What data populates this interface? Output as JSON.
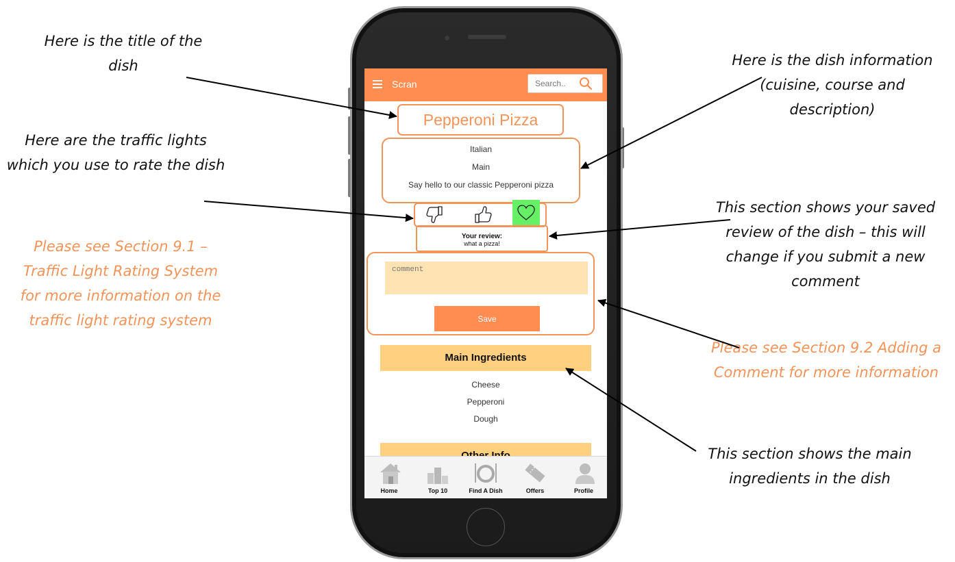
{
  "annotations": {
    "title_note": "Here is the title of the dish",
    "traffic_note": "Here are the traffic lights which you use to rate the dish",
    "section91_note": "Please see Section 9.1 – Traffic Light Rating System for more information on the traffic light rating system",
    "info_note": "Here is the dish information (cuisine, course and description)",
    "review_note": "This section shows your saved review of the dish – this will change if you submit a new comment",
    "section92_note": "Please see Section 9.2 Adding a Comment for more information",
    "ingredients_note": "This section shows the main ingredients in the dish"
  },
  "colors": {
    "accent": "#ff8c50",
    "annotation_orange": "#f2945a",
    "header_yellow": "#ffd080",
    "input_bg": "#ffe3b3",
    "favorite_green": "#66f066"
  },
  "app": {
    "title": "Scran",
    "search_placeholder": "Search..",
    "menu_icon": "hamburger-menu-icon",
    "search_icon": "magnifier-icon"
  },
  "dish": {
    "title": "Pepperoni Pizza",
    "cuisine": "Italian",
    "course": "Main",
    "description": "Say hello to our classic Pepperoni pizza"
  },
  "rating": {
    "icons": [
      "thumbs-down-icon",
      "thumbs-up-icon",
      "heart-icon"
    ],
    "selected": "heart"
  },
  "review": {
    "label": "Your review:",
    "text": "what a pizza!"
  },
  "comment": {
    "placeholder": "comment",
    "save_label": "Save"
  },
  "ingredients": {
    "header": "Main Ingredients",
    "items": [
      "Cheese",
      "Pepperoni",
      "Dough"
    ]
  },
  "other_info": {
    "header": "Other Info"
  },
  "tabs": [
    {
      "label": "Home",
      "icon": "home-icon"
    },
    {
      "label": "Top 10",
      "icon": "top10-podium-icon"
    },
    {
      "label": "Find A Dish",
      "icon": "plate-cutlery-icon"
    },
    {
      "label": "Offers",
      "icon": "ticket-icon"
    },
    {
      "label": "Profile",
      "icon": "person-icon"
    }
  ]
}
